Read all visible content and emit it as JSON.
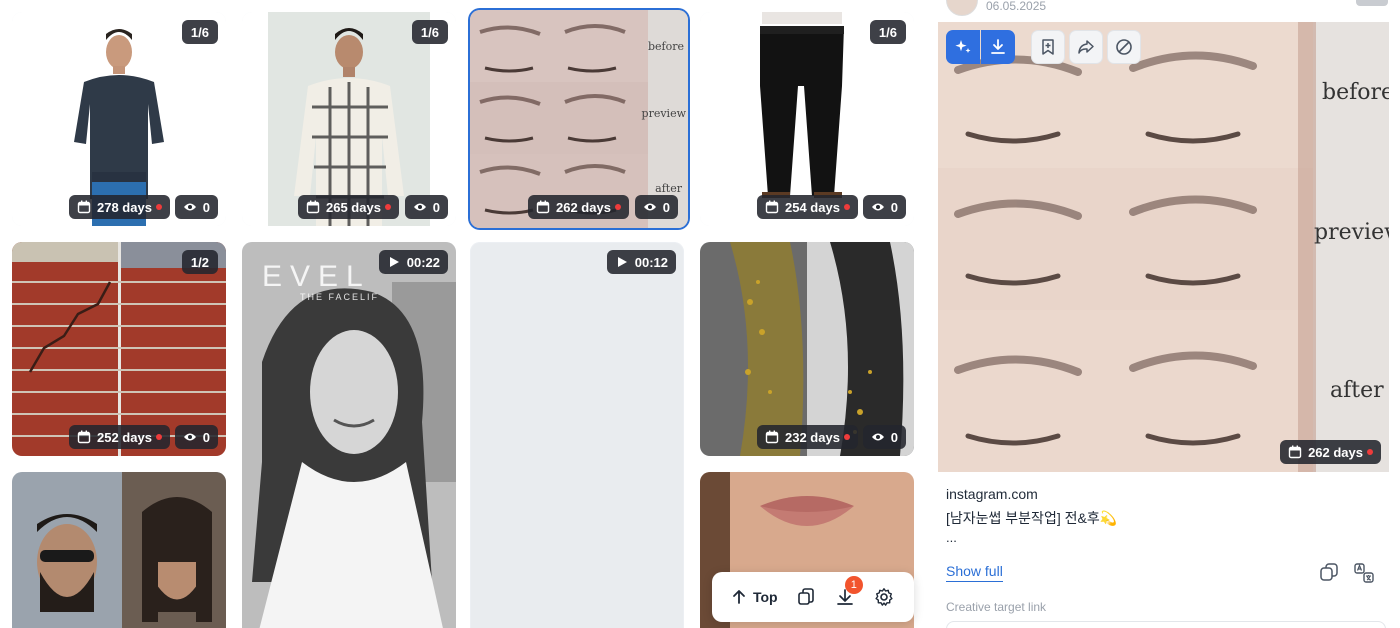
{
  "grid": {
    "cards": [
      {
        "name": "card-sweater",
        "counter": "1/6",
        "days": "278 days",
        "views": "0"
      },
      {
        "name": "card-plaid-shirt",
        "counter": "1/6",
        "days": "265 days",
        "views": "0"
      },
      {
        "name": "card-eyebrows",
        "days": "262 days",
        "views": "0",
        "labels": [
          "before",
          "preview",
          "after"
        ]
      },
      {
        "name": "card-black-jeans",
        "counter": "1/6",
        "days": "254 days",
        "views": "0"
      },
      {
        "name": "card-brick-wall",
        "counter": "1/2",
        "days": "252 days",
        "views": "0"
      },
      {
        "name": "card-woman-video",
        "duration": "00:22",
        "overlay_text": "EVEL",
        "overlay_sub": "THE FACELIF"
      },
      {
        "name": "card-blank-video",
        "duration": "00:12"
      },
      {
        "name": "card-hair-fiber",
        "days": "232 days",
        "views": "0"
      },
      {
        "name": "card-beard-man"
      },
      {
        "name": "card-lips"
      }
    ]
  },
  "floating_bar": {
    "top_label": "Top",
    "download_badge": "1"
  },
  "panel": {
    "date": "06.05.2025",
    "preview_labels": [
      "before",
      "preview",
      "after"
    ],
    "preview_days": "262 days",
    "domain": "instagram.com",
    "caption": "[남자눈썹 부분작업] 전&후💫",
    "ellipsis": "...",
    "show_full": "Show full",
    "creative_target_label": "Creative target link"
  },
  "colors": {
    "accent": "#2f6fe0",
    "badge": "#f2542d",
    "dot": "#ef3b3b"
  }
}
